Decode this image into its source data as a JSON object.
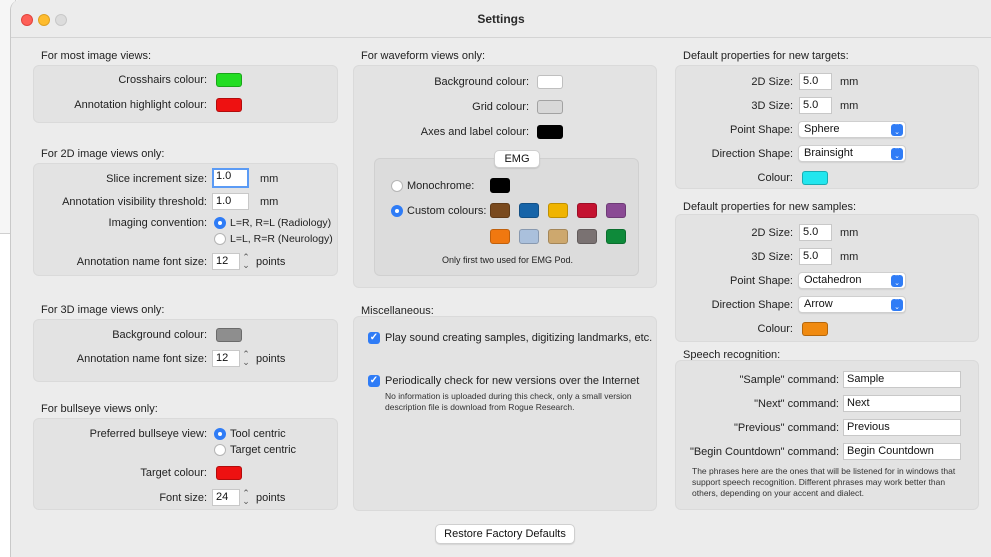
{
  "window": {
    "title": "Settings"
  },
  "colors": {
    "green": "#22dd22",
    "red": "#ee1111",
    "gray": "#8e8e8e",
    "cyan": "#22e6ee",
    "orange": "#f08a10",
    "white": "#ffffff",
    "lightgray": "#d8d8d8",
    "black": "#000000",
    "accent": "#2f7cf6"
  },
  "image_views": {
    "title": "For most image views:",
    "crosshairs_label": "Crosshairs colour:",
    "annotation_highlight_label": "Annotation highlight colour:"
  },
  "views_2d": {
    "title": "For 2D image views only:",
    "slice_increment_label": "Slice increment size:",
    "slice_increment_value": "1.0",
    "slice_increment_unit": "mm",
    "visibility_label": "Annotation visibility threshold:",
    "visibility_value": "1.0",
    "visibility_unit": "mm",
    "convention_label": "Imaging convention:",
    "radiology": "L=R, R=L (Radiology)",
    "neurology": "L=L, R=R (Neurology)",
    "font_label": "Annotation name font size:",
    "font_value": "12",
    "font_unit": "points"
  },
  "views_3d": {
    "title": "For 3D image views only:",
    "bg_label": "Background colour:",
    "font_label": "Annotation name font size:",
    "font_value": "12",
    "font_unit": "points"
  },
  "bullseye": {
    "title": "For bullseye views only:",
    "preferred_label": "Preferred bullseye view:",
    "tool_centric": "Tool centric",
    "target_centric": "Target centric",
    "target_colour_label": "Target colour:",
    "font_label": "Font size:",
    "font_value": "24",
    "font_unit": "points"
  },
  "waveform": {
    "title": "For waveform views only:",
    "bg_label": "Background colour:",
    "grid_label": "Grid colour:",
    "axes_label": "Axes and label colour:",
    "emg_tab": "EMG",
    "monochrome_label": "Monochrome:",
    "custom_label": "Custom colours:",
    "emg_note": "Only first two used for EMG Pod.",
    "custom_colours": [
      "#7a4a1e",
      "#1764a8",
      "#f0b400",
      "#c41230",
      "#8a4a94",
      "#f07810",
      "#aac0dc",
      "#cda86e",
      "#7a7272",
      "#0e8a3a"
    ]
  },
  "misc": {
    "title": "Miscellaneous:",
    "sound_label": "Play sound creating samples, digitizing landmarks, etc.",
    "updates_label": "Periodically check for new versions over the Internet",
    "updates_note": "No information is uploaded during this check, only a small version description file is download from Rogue Research."
  },
  "targets": {
    "title": "Default properties for new targets:",
    "size2d_label": "2D Size:",
    "size2d_value": "5.0",
    "size3d_label": "3D Size:",
    "size3d_value": "5.0",
    "unit": "mm",
    "point_label": "Point Shape:",
    "point_value": "Sphere",
    "direction_label": "Direction Shape:",
    "direction_value": "Brainsight",
    "colour_label": "Colour:"
  },
  "samples": {
    "title": "Default properties for new samples:",
    "size2d_label": "2D Size:",
    "size2d_value": "5.0",
    "size3d_label": "3D Size:",
    "size3d_value": "5.0",
    "unit": "mm",
    "point_label": "Point Shape:",
    "point_value": "Octahedron",
    "direction_label": "Direction Shape:",
    "direction_value": "Arrow",
    "colour_label": "Colour:"
  },
  "speech": {
    "title": "Speech recognition:",
    "sample_label": "\"Sample\" command:",
    "sample_value": "Sample",
    "next_label": "\"Next\" command:",
    "next_value": "Next",
    "previous_label": "\"Previous\" command:",
    "previous_value": "Previous",
    "countdown_label": "\"Begin Countdown\" command:",
    "countdown_value": "Begin Countdown",
    "note": "The phrases here are the ones that will be listened for in windows that support speech recognition. Different phrases may work better than others, depending on your accent and dialect."
  },
  "footer": {
    "restore_label": "Restore Factory Defaults"
  }
}
